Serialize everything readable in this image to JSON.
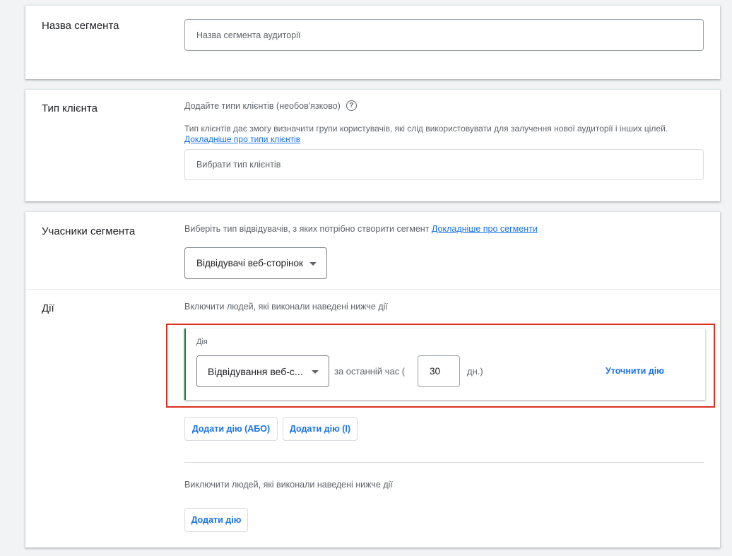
{
  "segment_name": {
    "title": "Назва сегмента",
    "placeholder": "Назва сегмента аудиторії"
  },
  "client_type": {
    "title": "Тип клієнта",
    "label": "Додайте типи клієнтів (необов'язково)",
    "help_icon": "question-circle-icon",
    "description": "Тип клієнтів дає змогу визначити групи користувачів, які слід використовувати для залучення нової аудиторії і інших цілей.",
    "link": "Докладніше про типи клієнтів",
    "placeholder": "Вибрати тип клієнтів"
  },
  "segment_members": {
    "title": "Учасники сегмента",
    "prompt": "Виберіть тип відвідувачів, з яких потрібно створити сегмент",
    "link": "Докладніше про сегменти",
    "dropdown_value": "Відвідувачі веб-сторінок"
  },
  "actions": {
    "title": "Дії",
    "include_label": "Включити людей, які виконали наведені нижче дії",
    "action_card": {
      "label": "Дія",
      "dropdown_value": "Відвідування веб-с...",
      "period_prefix": "за останній час (",
      "days_value": "30",
      "period_suffix": "дн.)",
      "refine_button": "Уточнити дію"
    },
    "add_or_button": "Додати дію (АБО)",
    "add_and_button": "Додати дію (І)",
    "exclude_label": "Виключити людей, які виконали наведені нижче дії",
    "add_exclude_button": "Додати дію"
  },
  "colors": {
    "accent": "#1a73e8",
    "highlight": "#d93025",
    "action_border": "#188038"
  }
}
